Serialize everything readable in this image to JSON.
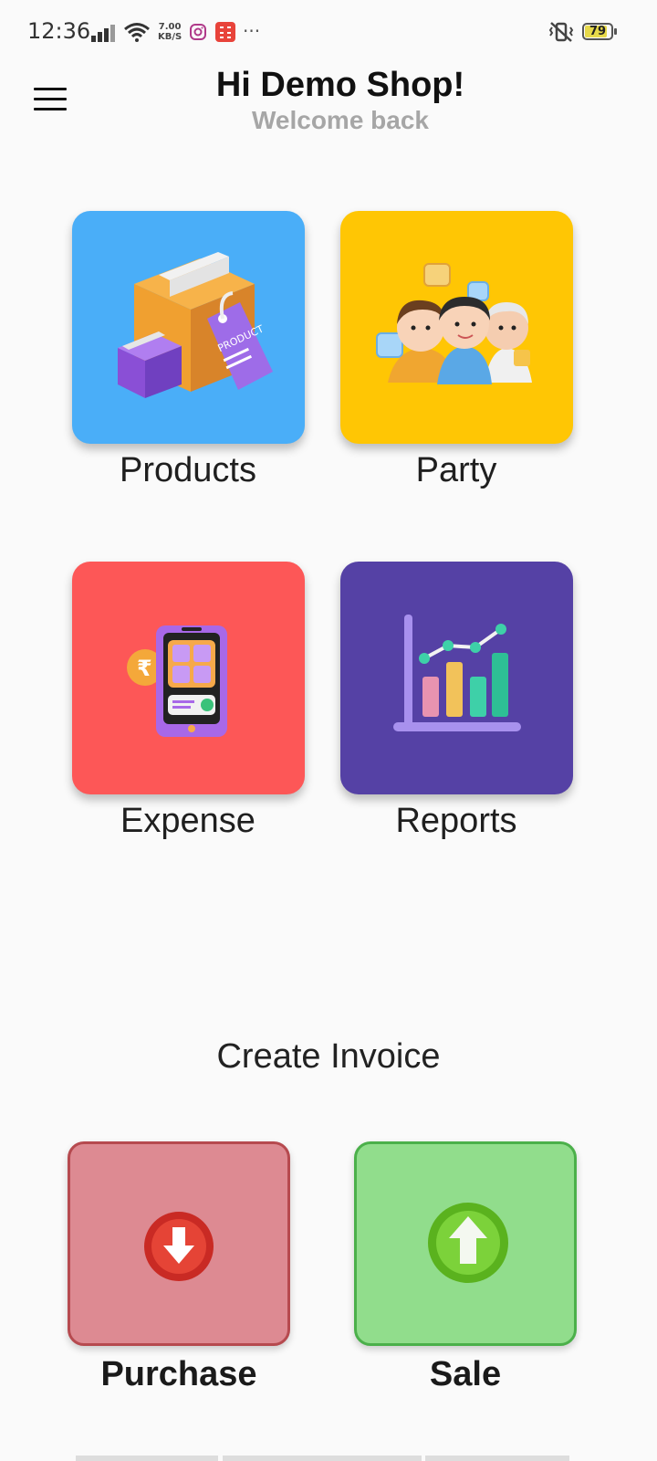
{
  "status_bar": {
    "time": "12:36",
    "net_speed_value": "7.00",
    "net_speed_unit": "KB/S",
    "battery_level": "79",
    "more": "···",
    "icons": [
      "signal-icon",
      "wifi-icon",
      "instagram-icon",
      "calculator-app-icon",
      "vibrate-icon",
      "battery-icon"
    ]
  },
  "header": {
    "greeting": "Hi Demo Shop!",
    "subtitle": "Welcome back"
  },
  "tiles": [
    {
      "label": "Products",
      "color": "#4aaef8",
      "icon": "product-box-icon"
    },
    {
      "label": "Party",
      "color": "#ffc604",
      "icon": "people-group-icon"
    },
    {
      "label": "Expense",
      "color": "#fd5757",
      "icon": "expense-phone-icon"
    },
    {
      "label": "Reports",
      "color": "#5541a5",
      "icon": "bar-chart-icon"
    }
  ],
  "invoice": {
    "title": "Create Invoice",
    "purchase": {
      "label": "Purchase",
      "color": "#dd8a92",
      "border": "#b64a4f",
      "icon": "arrow-down-icon"
    },
    "sale": {
      "label": "Sale",
      "color": "#91dd8c",
      "border": "#4bb04a",
      "icon": "arrow-up-icon"
    }
  }
}
